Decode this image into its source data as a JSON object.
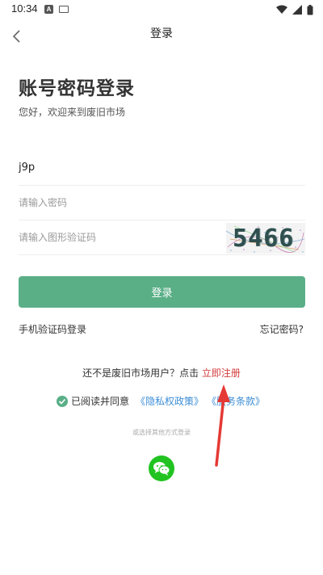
{
  "status_bar": {
    "time": "10:34",
    "a_badge": "A"
  },
  "nav": {
    "title": "登录"
  },
  "heading": "账号密码登录",
  "subheading": "您好，欢迎来到废旧市场",
  "form": {
    "username_value": "j9p",
    "password_placeholder": "请输入密码",
    "captcha_placeholder": "请输入图形验证码",
    "captcha_text": "5466",
    "login_label": "登录"
  },
  "links": {
    "sms_login": "手机验证码登录",
    "forgot_password": "忘记密码?"
  },
  "register": {
    "prompt": "还不是废旧市场用户？点击",
    "link": "立即注册"
  },
  "agreement": {
    "text": "已阅读并同意",
    "privacy": "《隐私权政策》",
    "terms": "《服务条款》"
  },
  "other_login": "或选择其他方式登录",
  "colors": {
    "accent": "#5aaf87",
    "register_link": "#d33b3b",
    "policy_link": "#3d8ed6",
    "wechat": "#21c321",
    "annotation": "#e53935"
  },
  "icons": [
    "back-icon",
    "wifi-icon",
    "cellular-icon",
    "battery-icon",
    "check-icon",
    "wechat-icon"
  ]
}
